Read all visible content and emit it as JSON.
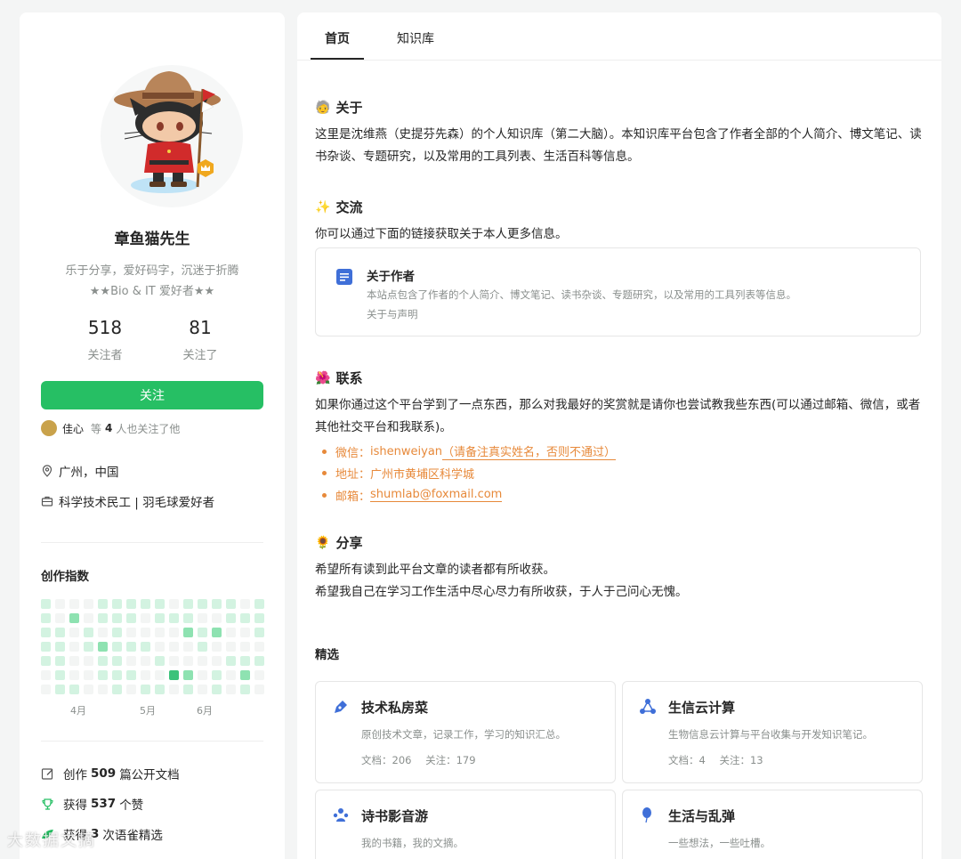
{
  "profile": {
    "name": "章鱼猫先生",
    "bio_line1": "乐于分享，爱好码字，沉迷于折腾",
    "bio_line2": "★★Bio & IT 爱好者★★",
    "followers_count": "518",
    "followers_label": "关注者",
    "following_count": "81",
    "following_label": "关注了",
    "follow_button": "关注",
    "follower_name": "佳心",
    "follower_prefix": "等",
    "follower_count": "4",
    "follower_suffix": "人也关注了他",
    "location": "广州，中国",
    "occupation": "科学技术民工 | 羽毛球爱好者"
  },
  "creation": {
    "title": "创作指数",
    "months": [
      "4月",
      "5月",
      "6月"
    ],
    "heatmap_levels": [
      [
        1,
        1,
        1,
        1,
        1,
        0,
        0
      ],
      [
        0,
        0,
        1,
        1,
        1,
        1,
        1
      ],
      [
        0,
        2,
        0,
        0,
        0,
        0,
        1
      ],
      [
        0,
        0,
        1,
        1,
        0,
        0,
        0
      ],
      [
        1,
        1,
        0,
        2,
        1,
        1,
        0
      ],
      [
        1,
        1,
        1,
        1,
        1,
        1,
        1
      ],
      [
        1,
        1,
        0,
        1,
        0,
        1,
        0
      ],
      [
        1,
        0,
        0,
        1,
        0,
        0,
        1
      ],
      [
        1,
        1,
        0,
        0,
        1,
        0,
        1
      ],
      [
        0,
        1,
        0,
        0,
        0,
        3,
        0
      ],
      [
        1,
        1,
        2,
        0,
        0,
        2,
        1
      ],
      [
        1,
        0,
        1,
        1,
        0,
        0,
        0
      ],
      [
        1,
        0,
        2,
        0,
        0,
        1,
        1
      ],
      [
        1,
        1,
        0,
        0,
        1,
        0,
        0
      ],
      [
        0,
        1,
        0,
        0,
        1,
        2,
        1
      ],
      [
        1,
        1,
        1,
        0,
        1,
        0,
        0
      ]
    ],
    "colors": [
      "#f3f5f4",
      "#d3f3e1",
      "#8ee2b1",
      "#3cc27a"
    ],
    "docs_prefix": "创作",
    "docs_count": "509",
    "docs_suffix": "篇公开文档",
    "likes_prefix": "获得",
    "likes_count": "537",
    "likes_suffix": "个赞",
    "picks_prefix": "获得",
    "picks_count": "3",
    "picks_suffix": "次语雀精选"
  },
  "tabs": [
    "首页",
    "知识库"
  ],
  "about": {
    "emoji": "🧓",
    "title": "关于",
    "text": "这里是沈维燕（史提芬先森）的个人知识库（第二大脑）。本知识库平台包含了作者全部的个人简介、博文笔记、读书杂谈、专题研究，以及常用的工具列表、生活百科等信息。"
  },
  "exchange": {
    "emoji": "✨",
    "title": "交流",
    "text": "你可以通过下面的链接获取关于本人更多信息。",
    "card_title": "关于作者",
    "card_desc": "本站点包含了作者的个人简介、博文笔记、读书杂谈、专题研究，以及常用的工具列表等信息。",
    "card_link": "关于与声明"
  },
  "contact": {
    "emoji": "🌺",
    "title": "联系",
    "text": "如果你通过这个平台学到了一点东西，那么对我最好的奖赏就是请你也尝试教我些东西(可以通过邮箱、微信，或者其他社交平台和我联系)。",
    "wechat_label": "微信：",
    "wechat_value": "ishenweiyan",
    "wechat_note": "（请备注真实姓名，否则不通过）",
    "address_label": "地址：",
    "address_value": "广州市黄埔区科学城",
    "email_label": "邮箱：",
    "email_value": "shumlab@foxmail.com"
  },
  "share": {
    "emoji": "🌻",
    "title": "分享",
    "line1": "希望所有读到此平台文章的读者都有所收获。",
    "line2": "希望我自己在学习工作生活中尽心尽力有所收获，于人于己问心无愧。"
  },
  "featured": {
    "label": "精选",
    "cards": [
      {
        "title": "技术私房菜",
        "desc": "原创技术文章，记录工作，学习的知识汇总。",
        "docs": "文档：206",
        "follows": "关注：179"
      },
      {
        "title": "生信云计算",
        "desc": "生物信息云计算与平台收集与开发知识笔记。",
        "docs": "文档：4",
        "follows": "关注：13"
      },
      {
        "title": "诗书影音游",
        "desc": "我的书籍，我的文摘。"
      },
      {
        "title": "生活与乱弹",
        "desc": "一些想法，一些吐槽。"
      }
    ],
    "icon_colors": [
      "#3f6fd8",
      "#3f6fd8",
      "#3f6fd8",
      "#3f6fd8"
    ]
  },
  "watermark": "大数据文摘"
}
